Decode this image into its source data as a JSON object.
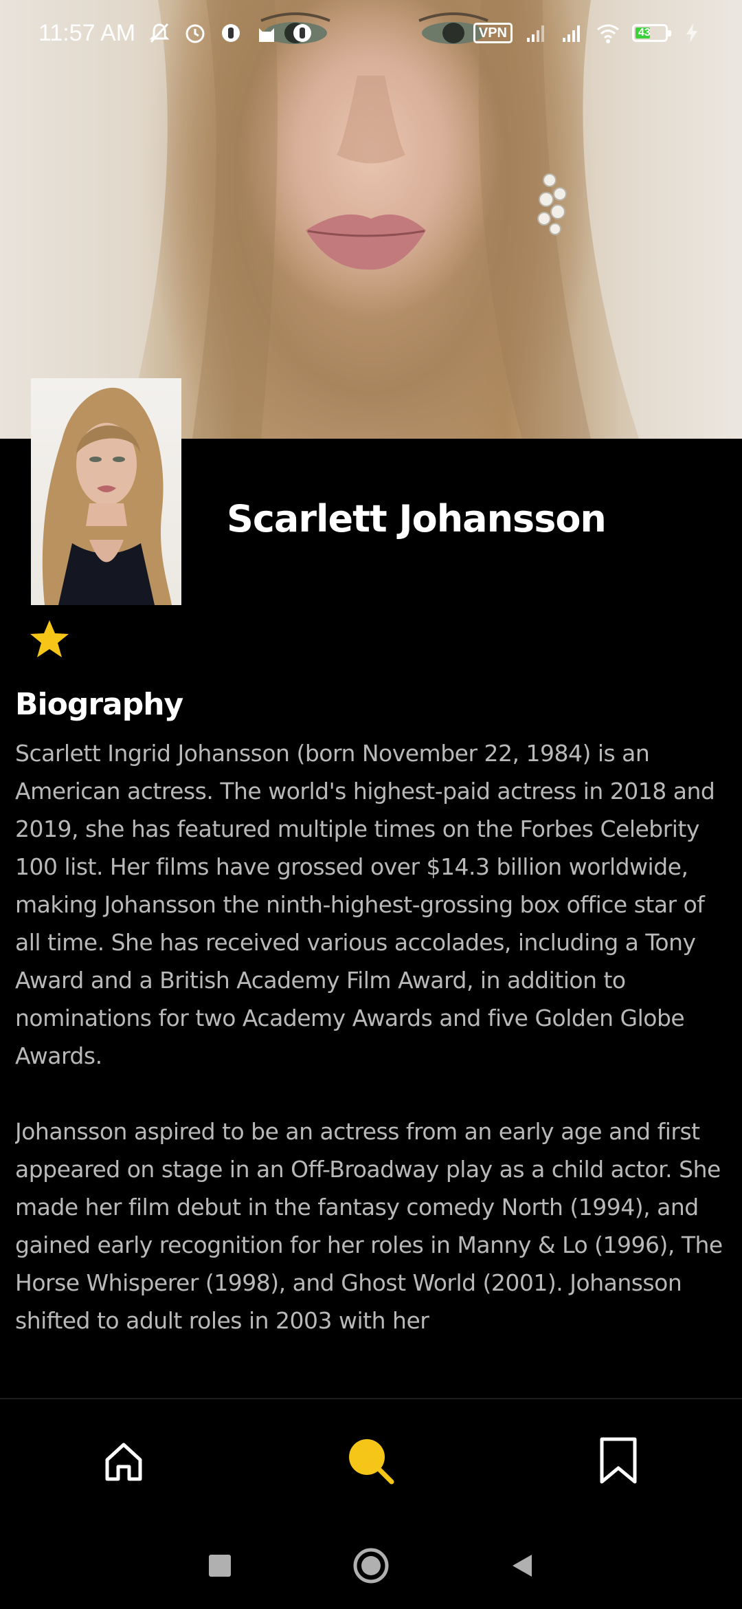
{
  "status_bar": {
    "time": "11:57 AM",
    "icons": [
      "mute-bell-icon",
      "alarm-icon",
      "app-icon",
      "cat-icon",
      "app-icon",
      "vpn-badge",
      "signal-icon",
      "signal-icon",
      "wifi-icon",
      "battery-icon",
      "charging-icon"
    ],
    "vpn_label": "VPN",
    "battery_level": "43"
  },
  "person": {
    "name": "Scarlett Johansson",
    "favorite_icon": "star-icon",
    "favorite_color": "#F5C518"
  },
  "biography": {
    "heading": "Biography",
    "paragraphs": [
      "Scarlett Ingrid Johansson (born November 22, 1984) is an American actress. The world's highest-paid actress in 2018 and 2019, she has featured multiple times on the Forbes Celebrity 100 list. Her films have grossed over $14.3 billion worldwide, making Johansson the ninth-highest-grossing box office star of all time. She has received various accolades, including a Tony Award and a British Academy Film Award, in addition to nominations for two Academy Awards and five Golden Globe Awards.",
      "Johansson aspired to be an actress from an early age and first appeared on stage in an Off-Broadway play as a child actor. She made her film debut in the fantasy comedy North (1994), and gained early recognition for her roles in Manny & Lo (1996), The Horse Whisperer (1998), and Ghost World (2001). Johansson shifted to adult roles in 2003 with her"
    ]
  },
  "bottom_nav": {
    "items": [
      {
        "icon": "home-icon",
        "active": false
      },
      {
        "icon": "search-icon",
        "active": true
      },
      {
        "icon": "bookmark-icon",
        "active": false
      }
    ],
    "accent_color": "#F5C518"
  },
  "system_nav": {
    "items": [
      "recents-icon",
      "home-circle-icon",
      "back-icon"
    ]
  }
}
